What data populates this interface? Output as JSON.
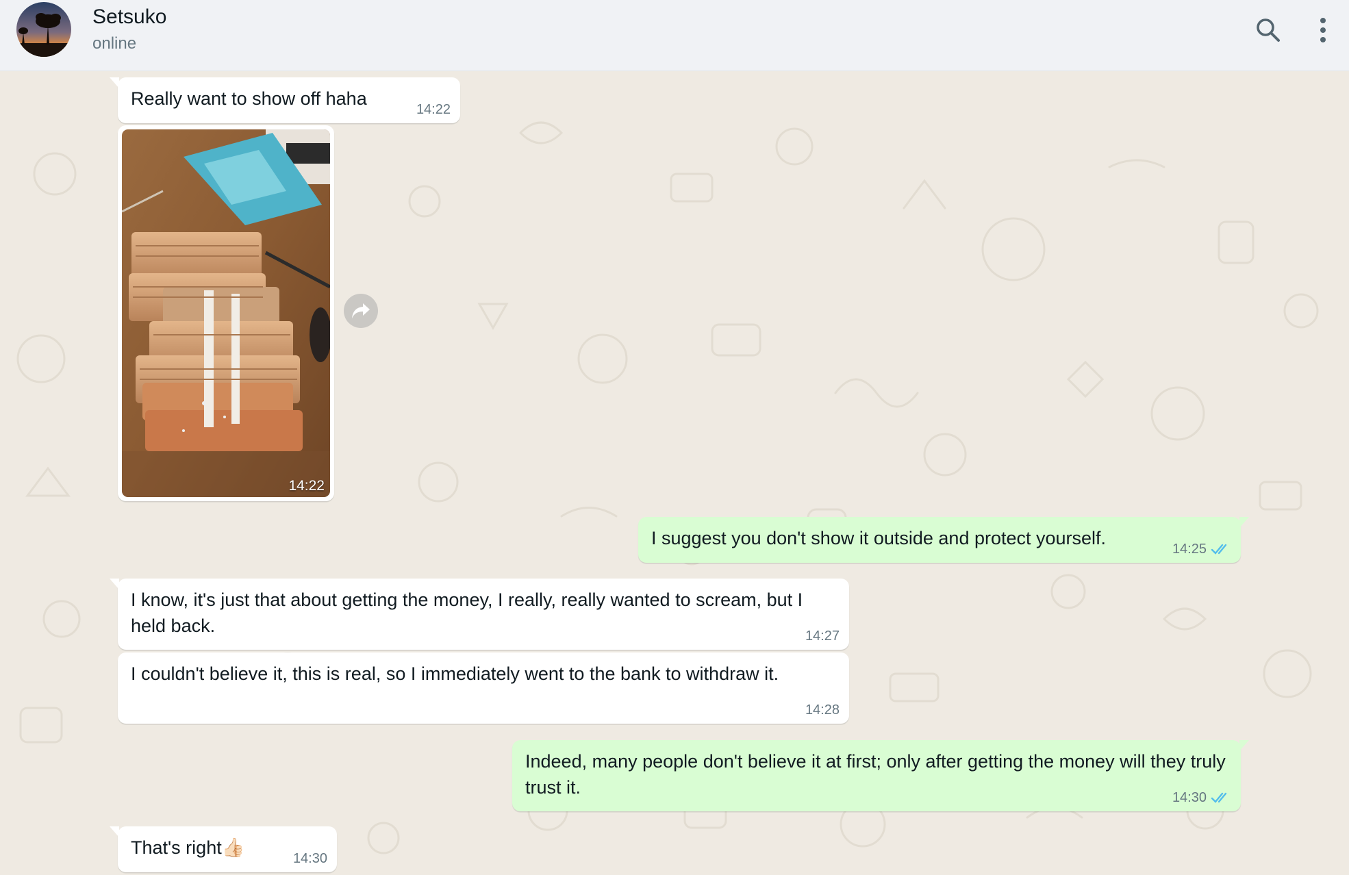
{
  "header": {
    "contact_name": "Setsuko",
    "status": "online",
    "search_icon": "search-icon",
    "menu_icon": "more-vertical-icon"
  },
  "messages": [
    {
      "direction": "incoming",
      "type": "text",
      "text": "Really want to show off haha",
      "time": "14:22"
    },
    {
      "direction": "incoming",
      "type": "image",
      "image_icon": "photo-of-banknote-stacks",
      "time": "14:22"
    },
    {
      "direction": "outgoing",
      "type": "text",
      "text": "I suggest you don't show it outside and protect yourself.",
      "time": "14:25",
      "status_icon": "double-check-read-icon"
    },
    {
      "direction": "incoming",
      "type": "text",
      "text": "I know, it's just that about getting the money, I really, really wanted to scream, but I held back.",
      "time": "14:27"
    },
    {
      "direction": "incoming",
      "type": "text",
      "text": "I couldn't believe it, this is real, so I immediately went to the bank to withdraw it.",
      "time": "14:28"
    },
    {
      "direction": "outgoing",
      "type": "text",
      "text": "Indeed, many people don't believe it at first; only after getting the money will they truly trust it.",
      "time": "14:30",
      "status_icon": "double-check-read-icon"
    },
    {
      "direction": "incoming",
      "type": "text",
      "text": "That's right👍🏻",
      "time": "14:30"
    }
  ],
  "colors": {
    "header_bg": "#f0f2f5",
    "chat_bg": "#efeae2",
    "incoming_bubble": "#ffffff",
    "outgoing_bubble": "#d9fdd3",
    "read_check": "#53bdeb"
  }
}
